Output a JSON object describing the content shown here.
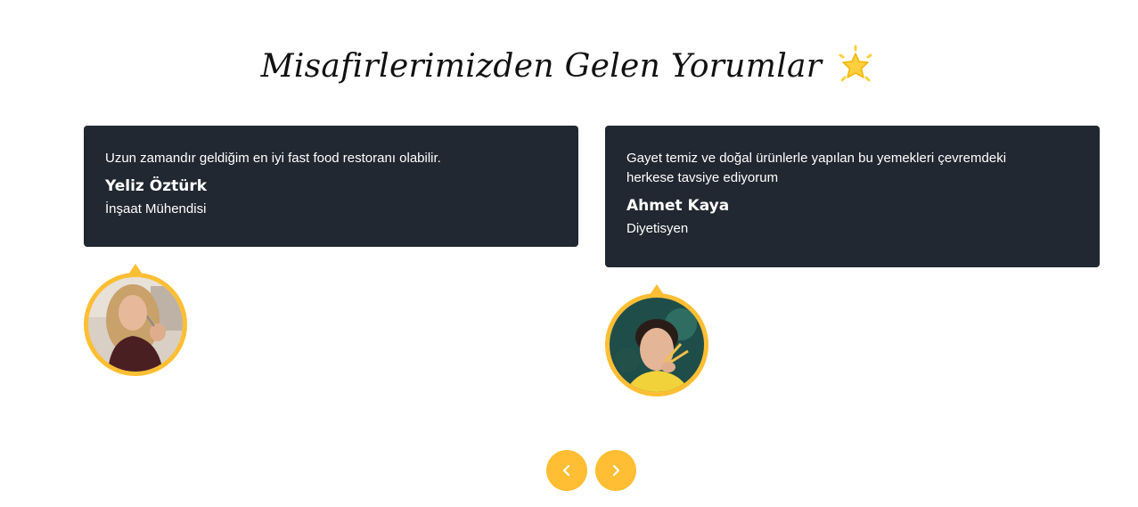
{
  "section": {
    "heading": "Misafirlerimizden Gelen Yorumlar",
    "heading_icon": "star-sparkle-icon"
  },
  "testimonials": [
    {
      "quote": "Uzun zamandır geldiğim en iyi fast food restoranı olabilir.",
      "name": "Yeliz Öztürk",
      "role": "İnşaat Mühendisi",
      "avatar": "woman-eating-photo"
    },
    {
      "quote": "Gayet temiz ve doğal ürünlerle yapılan bu yemekleri çevremdeki herkese tavsiye ediyorum",
      "name": "Ahmet Kaya",
      "role": "Diyetisyen",
      "avatar": "man-eating-fries-photo"
    }
  ],
  "carousel": {
    "prev_icon": "chevron-left-icon",
    "next_icon": "chevron-right-icon"
  },
  "colors": {
    "accent": "#ffbe33",
    "card_bg": "#222831",
    "card_text": "#ffffff",
    "heading_text": "#111111"
  }
}
